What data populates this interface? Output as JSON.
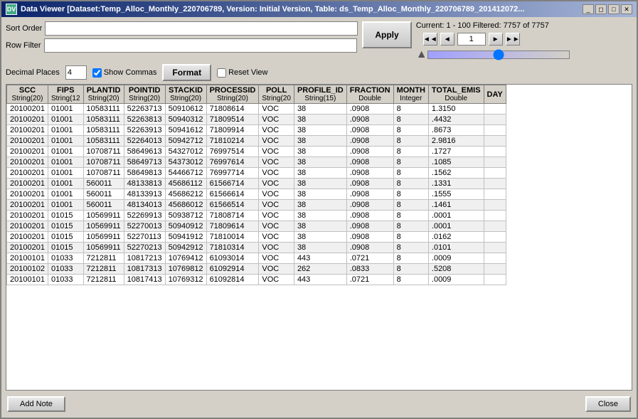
{
  "window": {
    "title": "Data Viewer [Dataset:Temp_Alloc_Monthly_220706789, Version: Initial Version, Table: ds_Temp_Alloc_Monthly_220706789_201412072...",
    "icon": "DV"
  },
  "toolbar": {
    "sort_order_label": "Sort Order",
    "row_filter_label": "Row Filter",
    "apply_label": "Apply",
    "current_info": "Current: 1 - 100  Filtered: 7757 of 7757",
    "page_value": "1",
    "decimal_places_label": "Decimal Places",
    "decimal_value": "4",
    "show_commas_label": "Show Commas",
    "format_label": "Format",
    "reset_view_label": "Reset View"
  },
  "nav": {
    "first": "◄◄",
    "prev": "◄",
    "next": "►",
    "last": "►►"
  },
  "table": {
    "columns": [
      {
        "name": "SCC",
        "type": "String(20)"
      },
      {
        "name": "FIPS",
        "type": "String(12"
      },
      {
        "name": "PLANTID",
        "type": "String(20)"
      },
      {
        "name": "POINTID",
        "type": "String(20)"
      },
      {
        "name": "STACKID",
        "type": "String(20)"
      },
      {
        "name": "PROCESSID",
        "type": "String(20)"
      },
      {
        "name": "POLL",
        "type": "String(20"
      },
      {
        "name": "PROFILE_ID",
        "type": "String(15)"
      },
      {
        "name": "FRACTION",
        "type": "Double"
      },
      {
        "name": "MONTH",
        "type": "Integer"
      },
      {
        "name": "TOTAL_EMIS",
        "type": "Double"
      },
      {
        "name": "DAY",
        "type": ""
      }
    ],
    "rows": [
      [
        "20100201",
        "01001",
        "10583111",
        "52263713",
        "50910612",
        "71808614",
        "VOC",
        "38",
        ".0908",
        "8",
        "1.3150",
        ""
      ],
      [
        "20100201",
        "01001",
        "10583111",
        "52263813",
        "50940312",
        "71809514",
        "VOC",
        "38",
        ".0908",
        "8",
        ".4432",
        ""
      ],
      [
        "20100201",
        "01001",
        "10583111",
        "52263913",
        "50941612",
        "71809914",
        "VOC",
        "38",
        ".0908",
        "8",
        ".8673",
        ""
      ],
      [
        "20100201",
        "01001",
        "10583111",
        "52264013",
        "50942712",
        "71810214",
        "VOC",
        "38",
        ".0908",
        "8",
        "2.9816",
        ""
      ],
      [
        "20100201",
        "01001",
        "10708711",
        "58649613",
        "54327012",
        "76997514",
        "VOC",
        "38",
        ".0908",
        "8",
        ".1727",
        ""
      ],
      [
        "20100201",
        "01001",
        "10708711",
        "58649713",
        "54373012",
        "76997614",
        "VOC",
        "38",
        ".0908",
        "8",
        ".1085",
        ""
      ],
      [
        "20100201",
        "01001",
        "10708711",
        "58649813",
        "54466712",
        "76997714",
        "VOC",
        "38",
        ".0908",
        "8",
        ".1562",
        ""
      ],
      [
        "20100201",
        "01001",
        "560011",
        "48133813",
        "45686112",
        "61566714",
        "VOC",
        "38",
        ".0908",
        "8",
        ".1331",
        ""
      ],
      [
        "20100201",
        "01001",
        "560011",
        "48133913",
        "45686212",
        "61566614",
        "VOC",
        "38",
        ".0908",
        "8",
        ".1555",
        ""
      ],
      [
        "20100201",
        "01001",
        "560011",
        "48134013",
        "45686012",
        "61566514",
        "VOC",
        "38",
        ".0908",
        "8",
        ".1461",
        ""
      ],
      [
        "20100201",
        "01015",
        "10569911",
        "52269913",
        "50938712",
        "71808714",
        "VOC",
        "38",
        ".0908",
        "8",
        ".0001",
        ""
      ],
      [
        "20100201",
        "01015",
        "10569911",
        "52270013",
        "50940912",
        "71809614",
        "VOC",
        "38",
        ".0908",
        "8",
        ".0001",
        ""
      ],
      [
        "20100201",
        "01015",
        "10569911",
        "52270113",
        "50941912",
        "71810014",
        "VOC",
        "38",
        ".0908",
        "8",
        ".0162",
        ""
      ],
      [
        "20100201",
        "01015",
        "10569911",
        "52270213",
        "50942912",
        "71810314",
        "VOC",
        "38",
        ".0908",
        "8",
        ".0101",
        ""
      ],
      [
        "20100101",
        "01033",
        "7212811",
        "10817213",
        "10769412",
        "61093014",
        "VOC",
        "443",
        ".0721",
        "8",
        ".0009",
        ""
      ],
      [
        "20100102",
        "01033",
        "7212811",
        "10817313",
        "10769812",
        "61092914",
        "VOC",
        "262",
        ".0833",
        "8",
        ".5208",
        ""
      ],
      [
        "20100101",
        "01033",
        "7212811",
        "10817413",
        "10769312",
        "61092814",
        "VOC",
        "443",
        ".0721",
        "8",
        ".0009",
        ""
      ]
    ]
  },
  "bottom": {
    "add_note_label": "Add Note",
    "close_label": "Close"
  }
}
